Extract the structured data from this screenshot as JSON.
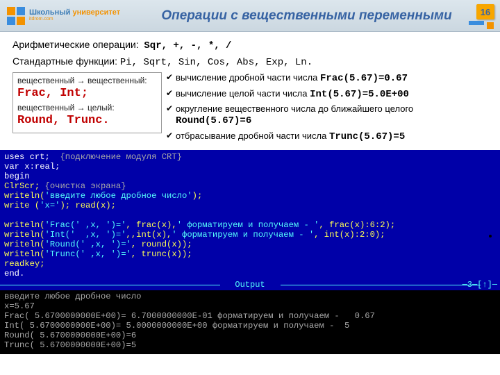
{
  "header": {
    "logo_line1": "Школьный",
    "logo_line2": "университет",
    "logo_sub": "itdrom.com",
    "title": "Операции с вещественными переменными",
    "page": "16"
  },
  "arith": {
    "label": "Арифметические операции:",
    "ops": "Sqr, +, -, *, /"
  },
  "std": {
    "label": "Стандартные функции:",
    "fns": "Pi, Sqrt, Sin, Cos, Abs, Exp, Ln."
  },
  "left": {
    "rr": "вещественный → вещественный:",
    "rr_fns": "Frac, Int;",
    "ri": "вещественный → целый:",
    "ri_fns": "Round, Trunc."
  },
  "bullets": {
    "b1a": "вычисление дробной части числа ",
    "b1b": "Frac(5.67)=0.67",
    "b2a": "вычисление целой части числа ",
    "b2b": "Int(5.67)=5.0E+00",
    "b3a": "округление вещественного числа до ближайшего целого ",
    "b3b": "Round(5.67)=6",
    "b4a": "отбрасывание дробной части числа ",
    "b4b": "Trunc(5.67)=5"
  },
  "code": {
    "l1a": "uses crt;  ",
    "l1b": "{подключение модуля CRT}",
    "l2": "var x:real;",
    "l3": "begin",
    "l4a": "ClrScr; ",
    "l4b": "{очистка экрана}",
    "l5a": "writeln(",
    "l5b": "'введите любое дробное число'",
    "l5c": ");",
    "l6a": "write (",
    "l6b": "'x='",
    "l6c": "); read(x);",
    "l7a": "writeln(",
    "l7b": "'Frac(' ,x, ')='",
    "l7c": ", frac(x),",
    "l7d": "' форматируем и получаем - '",
    "l7e": ", frac(x):6:2);",
    "l8a": "writeln(",
    "l8b": "'Int('  ,x, ')='",
    "l8c": ",,int(x),",
    "l8d": "' форматируем и получаем - '",
    "l8e": ", int(x):2:0);",
    "l9a": "writeln(",
    "l9b": "'Round(' ,x, ')='",
    "l9c": ", round(x));",
    "l10a": "writeln(",
    "l10b": "'Trunc(' ,x, ')='",
    "l10c": ", trunc(x));",
    "l11": "readkey;",
    "l12": "end."
  },
  "sep": {
    "label": " Output ",
    "end": "─3─[↑]─"
  },
  "out": {
    "o1": "введите любое дробное число",
    "o2": "x=5.67",
    "o3": "Frac( 5.6700000000E+00)= 6.7000000000E-01 форматируем и получаем -   0.67",
    "o4": "Int( 5.6700000000E+00)= 5.0000000000E+00 форматируем и получаем -  5",
    "o5": "Round( 5.6700000000E+00)=6",
    "o6": "Trunc( 5.6700000000E+00)=5"
  }
}
